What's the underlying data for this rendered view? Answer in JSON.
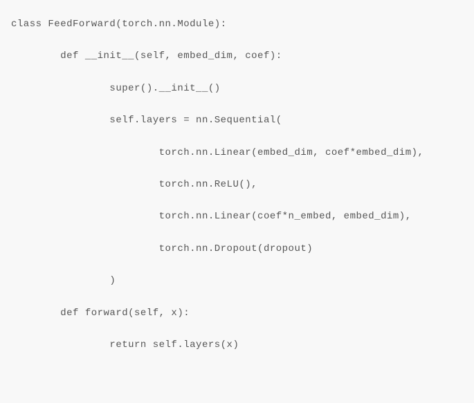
{
  "code": {
    "lines": [
      "class FeedForward(torch.nn.Module):",
      "        def __init__(self, embed_dim, coef):",
      "                super().__init__()",
      "                self.layers = nn.Sequential(",
      "                        torch.nn.Linear(embed_dim, coef*embed_dim),",
      "                        torch.nn.ReLU(),",
      "                        torch.nn.Linear(coef*n_embed, embed_dim),",
      "                        torch.nn.Dropout(dropout)",
      "                )",
      "        def forward(self, x):",
      "                return self.layers(x)"
    ]
  }
}
